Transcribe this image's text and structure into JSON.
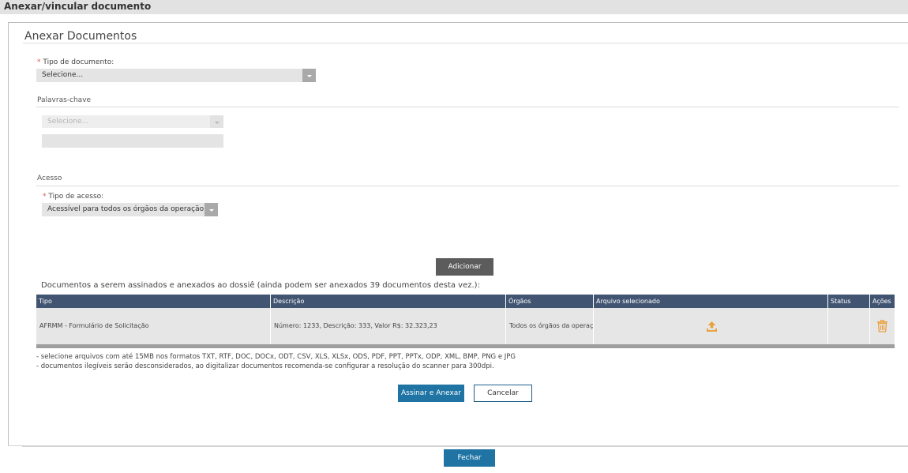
{
  "window": {
    "title": "Anexar/vincular documento"
  },
  "panel": {
    "title": "Anexar Documentos"
  },
  "form": {
    "tipo_documento": {
      "required_mark": "*",
      "label": "Tipo de documento:",
      "value": "Selecione..."
    },
    "palavras_chave": {
      "section_label": "Palavras-chave",
      "select_placeholder": "Selecione...",
      "input_value": ""
    },
    "acesso": {
      "section_label": "Acesso",
      "tipo_acesso": {
        "required_mark": "*",
        "label": "Tipo de acesso:",
        "value": "Acessível para todos os órgãos da operação"
      }
    },
    "add_button_label": "Adicionar"
  },
  "documents": {
    "caption": "Documentos a serem assinados e anexados ao dossiê (ainda podem ser anexados 39 documentos desta vez.):",
    "columns": [
      "Tipo",
      "Descrição",
      "Órgãos",
      "Arquivo selecionado",
      "Status",
      "Ações"
    ],
    "rows": [
      {
        "tipo": "AFRMM - Formulário de Solicitação",
        "descricao": "Número: 1233, Descrição: 333, Valor R$: 32.323,23",
        "orgaos": "Todos os órgãos da operação",
        "arquivo_icon": "upload-icon",
        "status": "",
        "acoes_icon": "trash-icon"
      }
    ]
  },
  "notes": [
    "- selecione arquivos com até 15MB nos formatos TXT, RTF, DOC, DOCx, ODT, CSV, XLS, XLSx, ODS, PDF, PPT, PPTx, ODP, XML, BMP, PNG e JPG",
    "- documentos ilegíveis serão desconsiderados, ao digitalizar documentos recomenda-se configurar a resolução do scanner para 300dpi."
  ],
  "actions": {
    "sign_attach_label": "Assinar e Anexar",
    "cancel_label": "Cancelar",
    "close_label": "Fechar"
  },
  "colors": {
    "header_bg": "#415472",
    "primary_button": "#1f74a4",
    "icon_orange": "#e8a23d",
    "required": "#d9534f"
  }
}
